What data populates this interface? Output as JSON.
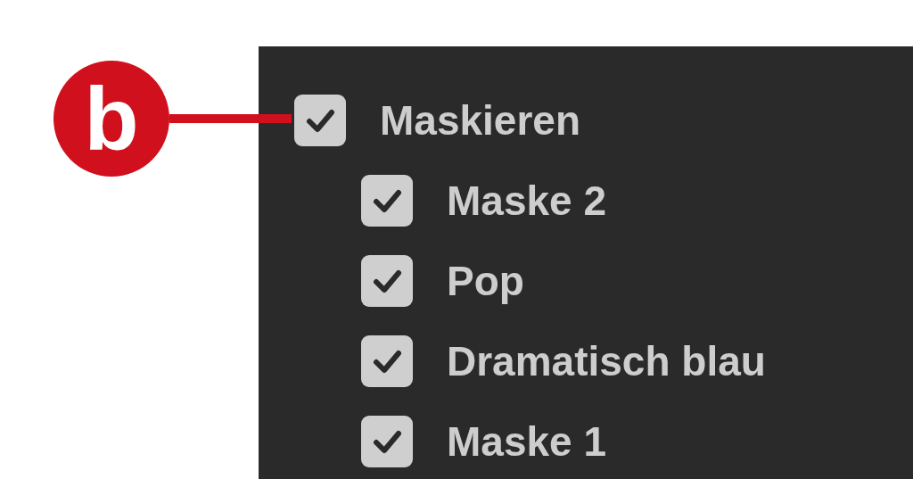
{
  "callout": {
    "label": "b"
  },
  "items": [
    {
      "label": "Maskieren",
      "checked": true,
      "children": [
        {
          "label": "Maske 2",
          "checked": true
        },
        {
          "label": "Pop",
          "checked": true
        },
        {
          "label": "Dramatisch blau",
          "checked": true
        },
        {
          "label": "Maske 1",
          "checked": true
        }
      ]
    }
  ]
}
